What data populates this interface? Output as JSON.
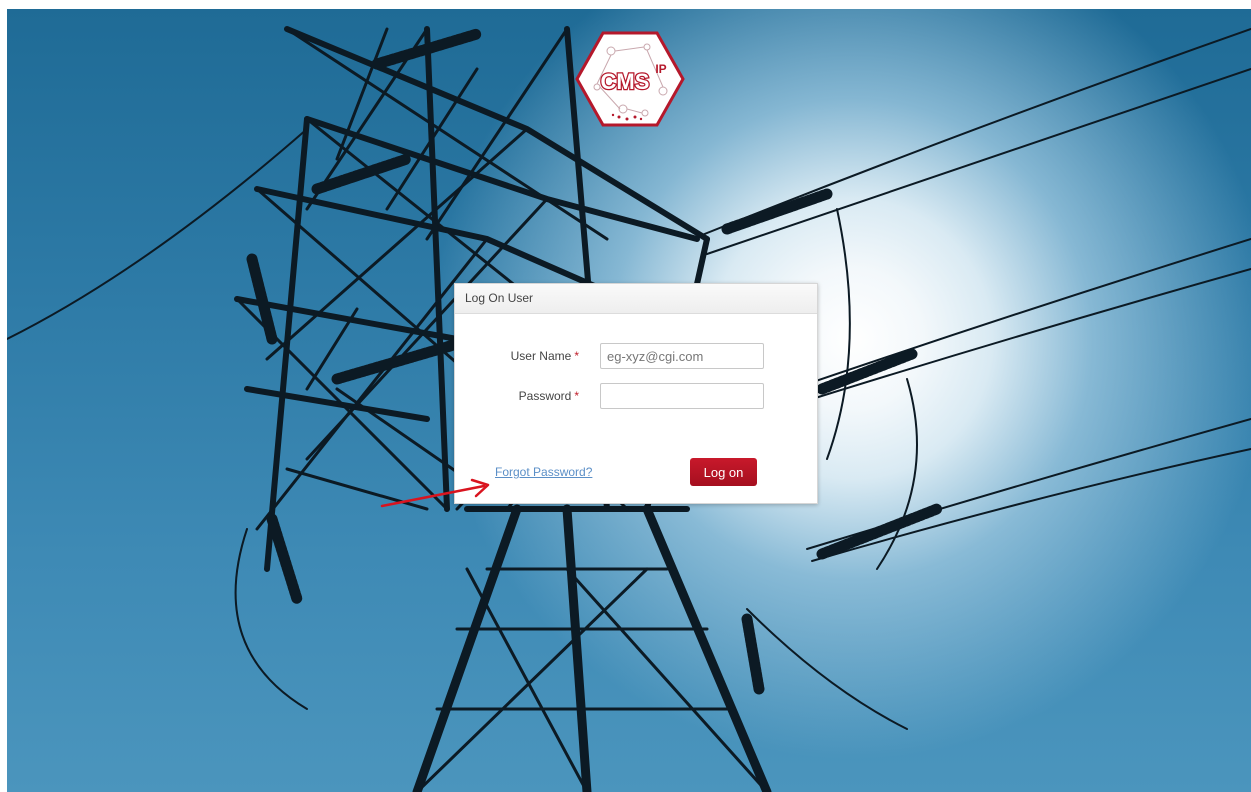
{
  "brand": {
    "logo_text": "CMS",
    "logo_superscript": "IP",
    "accent_color": "#b5182b"
  },
  "login": {
    "title": "Log On User",
    "username_label": "User Name",
    "username_placeholder": "eg-xyz@cgi.com",
    "username_value": "",
    "password_label": "Password",
    "password_value": "",
    "required_marker": "*",
    "forgot_password_link": "Forgot Password?",
    "logon_button": "Log on"
  },
  "annotation": {
    "arrow_color": "#d9141f",
    "arrow_target": "forgot-password-link"
  }
}
